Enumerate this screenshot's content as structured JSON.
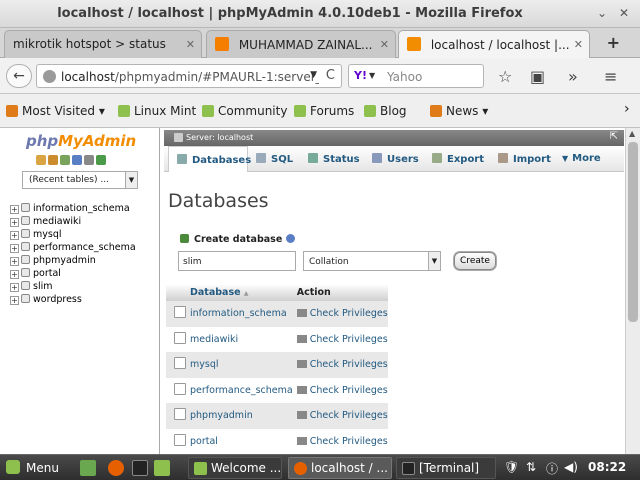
{
  "window": {
    "title": "localhost / localhost | phpMyAdmin 4.0.10deb1 - Mozilla Firefox",
    "minimize": "⌄",
    "close": "✕"
  },
  "tabs": [
    {
      "label": "mikrotik hotspot > status",
      "close": "✕"
    },
    {
      "label": "MUHAMMAD ZAINAL...",
      "close": "✕"
    },
    {
      "label": "localhost / localhost |...",
      "close": "✕",
      "active": true
    }
  ],
  "new_tab": "+",
  "nav": {
    "back": "←",
    "url_prefix": "localhost",
    "url_rest": "/phpmyadmin/#PMAURL-1:server_",
    "url_drop": "▼",
    "reload": "C",
    "search_placeholder": "Yahoo",
    "search_logo": "Y!",
    "search_drop": "▼",
    "bookmark_star": "☆",
    "reading_list": "▣",
    "overflow": "»",
    "menu": "≡"
  },
  "bookmarks": {
    "items": [
      "Most Visited",
      "Linux Mint",
      "Community",
      "Forums",
      "Blog",
      "News"
    ],
    "most_visited_arrow": "▾",
    "news_arrow": "▾",
    "overflow": "›"
  },
  "pma_left": {
    "logo_php": "php",
    "logo_myadmin": "MyAdmin",
    "recent_tables": "(Recent tables) ...",
    "recent_drop": "▼",
    "databases": [
      "information_schema",
      "mediawiki",
      "mysql",
      "performance_schema",
      "phpmyadmin",
      "portal",
      "slim",
      "wordpress"
    ]
  },
  "pma_right": {
    "server_breadcrumb": "Server: localhost",
    "collapse": "⇱",
    "menu": [
      "Databases",
      "SQL",
      "Status",
      "Users",
      "Export",
      "Import",
      "More"
    ],
    "more_arrow": "▼",
    "heading": "Databases",
    "create_label": "Create database",
    "db_name_value": "slim",
    "collation_value": "Collation",
    "collation_drop": "▼",
    "create_button": "Create",
    "table_headers": {
      "database": "Database",
      "sort": "▲",
      "action": "Action"
    },
    "rows": [
      {
        "db": "information_schema",
        "action": "Check Privileges"
      },
      {
        "db": "mediawiki",
        "action": "Check Privileges"
      },
      {
        "db": "mysql",
        "action": "Check Privileges"
      },
      {
        "db": "performance_schema",
        "action": "Check Privileges"
      },
      {
        "db": "phpmyadmin",
        "action": "Check Privileges"
      },
      {
        "db": "portal",
        "action": "Check Privileges"
      }
    ],
    "scroll_up": "▲"
  },
  "taskbar": {
    "menu_label": "Menu",
    "tasks": [
      {
        "label": "Welcome ..."
      },
      {
        "label": "localhost / ...",
        "active": true
      },
      {
        "label": "[Terminal]"
      }
    ],
    "tray_shield": "🛡",
    "tray_net": "⇅",
    "tray_volume": "◀)",
    "clock": "08:22"
  },
  "colors": {
    "link": "#235a81",
    "pma_orange": "#f28c00",
    "pma_blue": "#6c78af",
    "row_odd": "#e8e8e8",
    "taskbar": "#2e2e2e"
  }
}
